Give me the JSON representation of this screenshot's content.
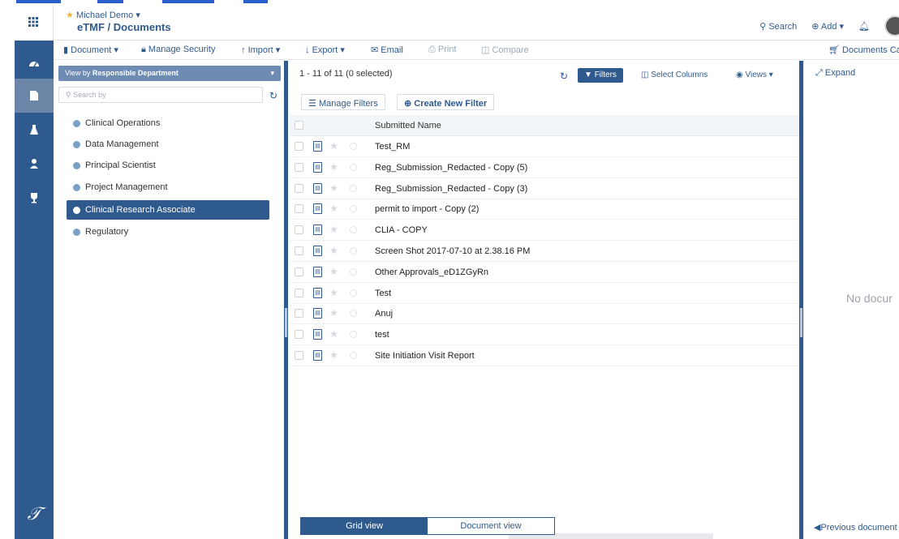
{
  "header": {
    "user_name": "Michael Demo",
    "breadcrumb": "eTMF / Documents",
    "search_label": "Search",
    "add_label": "Add"
  },
  "toolbar": {
    "document": "Document",
    "manage_security": "Manage Security",
    "import": "Import",
    "export": "Export",
    "email": "Email",
    "print": "Print",
    "compare": "Compare",
    "documents_cart": "Documents Ca"
  },
  "left_panel": {
    "view_by_prefix": "View by",
    "view_by_value": "Responsible Department",
    "search_placeholder": "Search by",
    "departments": [
      {
        "label": "Clinical Operations"
      },
      {
        "label": "Data Management"
      },
      {
        "label": "Principal Scientist"
      },
      {
        "label": "Project Management"
      },
      {
        "label": "Clinical Research Associate",
        "active": true
      },
      {
        "label": "Regulatory"
      }
    ]
  },
  "center_panel": {
    "count": "1 - 11 of 11 (0 selected)",
    "filters_label": "Filters",
    "select_columns_label": "Select Columns",
    "views_label": "Views",
    "manage_filters_label": "Manage Filters",
    "create_filter_label": "Create New Filter",
    "column_header": "Submitted Name",
    "rows": [
      "Test_RM",
      "Reg_Submission_Redacted - Copy (5)",
      "Reg_Submission_Redacted - Copy (3)",
      "permit to import - Copy (2)",
      "CLIA - COPY",
      "Screen Shot 2017-07-10 at 2.38.16 PM",
      "Other Approvals_eD1ZGyRn",
      "Test",
      "Anuj",
      "test",
      "Site Initiation Visit Report"
    ],
    "grid_view_label": "Grid view",
    "document_view_label": "Document view"
  },
  "right_panel": {
    "expand_label": "Expand",
    "empty_text": "No docur",
    "previous_label": "Previous document"
  },
  "colors": {
    "primary": "#2f5a8e",
    "rail": "#2f5a8e",
    "accent_star": "#f3b33d"
  }
}
